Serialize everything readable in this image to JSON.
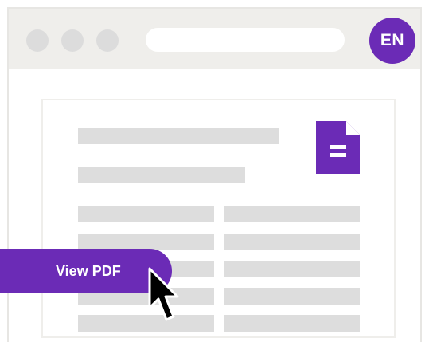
{
  "browser": {
    "language_badge": "EN",
    "address_bar_value": ""
  },
  "document": {
    "icon": "document-icon"
  },
  "actions": {
    "view_pdf_label": "View PDF"
  },
  "pointer": {
    "icon": "mouse-cursor-icon"
  },
  "colors": {
    "accent": "#6b2bb6",
    "chrome": "#efeeeb",
    "placeholder_lines": "#dddddd",
    "window_dots": "#dcdcdc"
  }
}
